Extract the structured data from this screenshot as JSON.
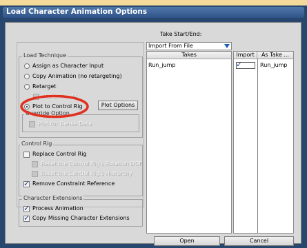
{
  "dialog": {
    "title": "Load Character Animation Options"
  },
  "take_range": {
    "label": "Take Start/End:",
    "value": "Import From File"
  },
  "load_technique": {
    "legend": "Load Technique",
    "options": [
      "Assign as Character Input",
      "Copy Animation (no retargeting)",
      "Retarget",
      "Plot to Control Rig"
    ],
    "selected": "Plot to Control Rig",
    "sub_option": "Match Pivots",
    "plot_options_button": "Plot Options"
  },
  "override": {
    "legend": "Override Option",
    "option": "Plot for Dense Data"
  },
  "control_rig": {
    "legend": "Control Rig",
    "replace": "Replace Control Rig",
    "reset_rotation": "Reset the Control Rig's Rotation DOF",
    "reset_hierarchy": "Reset the Control Rig's Hierarchy",
    "remove_constraint": "Remove Constraint Reference"
  },
  "extensions": {
    "legend": "Character Extensions",
    "process": "Process Animation",
    "copy_missing": "Copy Missing Character Extensions"
  },
  "takes": {
    "header": "Takes",
    "items": [
      "Run_jump"
    ]
  },
  "import": {
    "header_import": "Import",
    "header_as_take": "As Take ...",
    "rows": [
      {
        "checked": true,
        "as_take": "Run_jump"
      }
    ]
  },
  "footer": {
    "open": "Open",
    "cancel": "Cancel"
  },
  "colors": {
    "title_bar": "#3a6196",
    "highlight_circle": "#e03020",
    "dialog_bg": "#d9d9d9"
  }
}
